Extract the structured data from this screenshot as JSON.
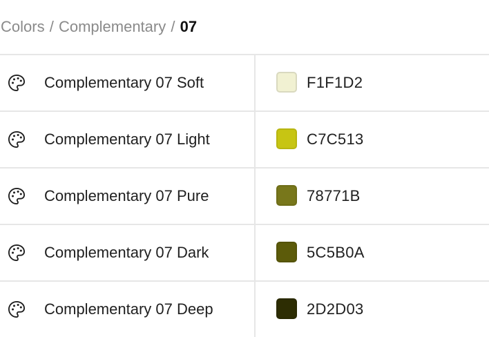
{
  "breadcrumb": {
    "parts": [
      "Colors",
      "Complementary"
    ],
    "separator": "/",
    "current": "07"
  },
  "colors": [
    {
      "name": "Complementary 07 Soft",
      "hex": "F1F1D2",
      "swatch": "#F1F1D2",
      "icon": "palette-icon"
    },
    {
      "name": "Complementary 07 Light",
      "hex": "C7C513",
      "swatch": "#C7C513",
      "icon": "palette-icon"
    },
    {
      "name": "Complementary 07 Pure",
      "hex": "78771B",
      "swatch": "#78771B",
      "icon": "palette-icon"
    },
    {
      "name": "Complementary 07 Dark",
      "hex": "5C5B0A",
      "swatch": "#5C5B0A",
      "icon": "palette-icon"
    },
    {
      "name": "Complementary 07 Deep",
      "hex": "2D2D03",
      "swatch": "#2D2D03",
      "icon": "palette-icon"
    }
  ]
}
